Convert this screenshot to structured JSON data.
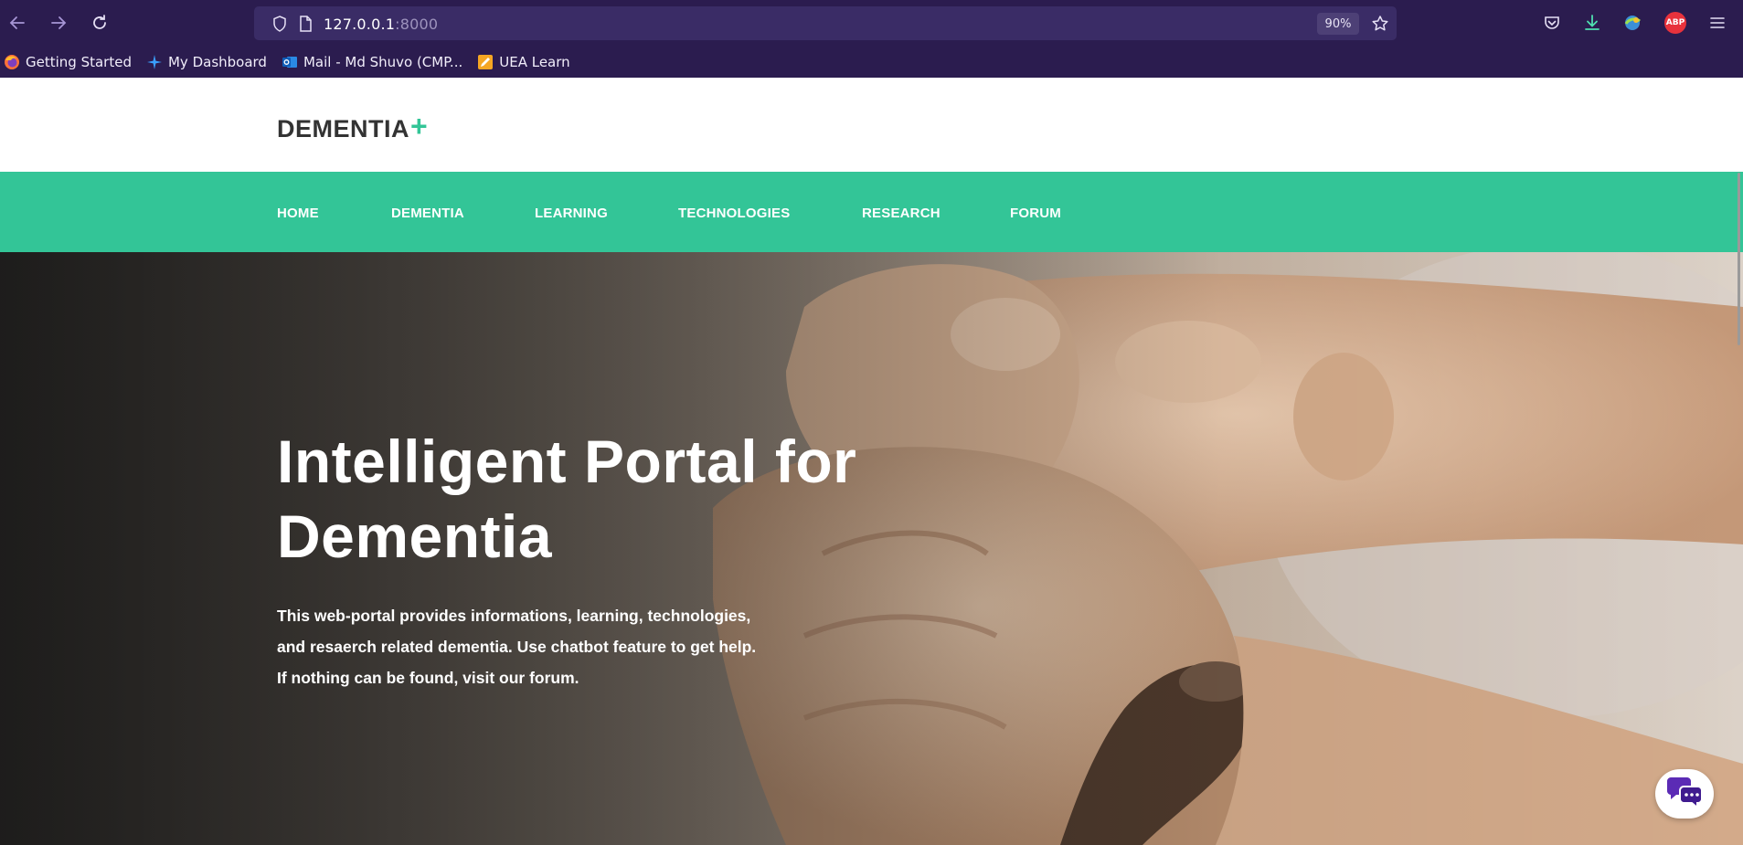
{
  "browser": {
    "url_host": "127.0.0.1",
    "url_port": ":8000",
    "zoom": "90%",
    "accent": "#2b1c4f"
  },
  "bookmarks": [
    {
      "label": "Getting Started",
      "icon": "firefox-icon"
    },
    {
      "label": "My Dashboard",
      "icon": "sparkle-icon"
    },
    {
      "label": "Mail - Md Shuvo (CMP...",
      "icon": "outlook-icon"
    },
    {
      "label": "UEA Learn",
      "icon": "pencil-icon"
    }
  ],
  "site": {
    "logo_text": "DEMENTIA",
    "logo_plus": "+",
    "brand_color": "#33c597"
  },
  "nav": {
    "items": [
      "HOME",
      "DEMENTIA",
      "LEARNING",
      "TECHNOLOGIES",
      "RESEARCH",
      "FORUM"
    ]
  },
  "hero": {
    "title_line1": "Intelligent Portal for",
    "title_line2": "Dementia",
    "desc_line1": "This web-portal provides informations, learning, technologies,",
    "desc_line2": "and resaerch related dementia. Use chatbot feature to get help.",
    "desc_line3": "If nothing can be found, visit our forum."
  }
}
